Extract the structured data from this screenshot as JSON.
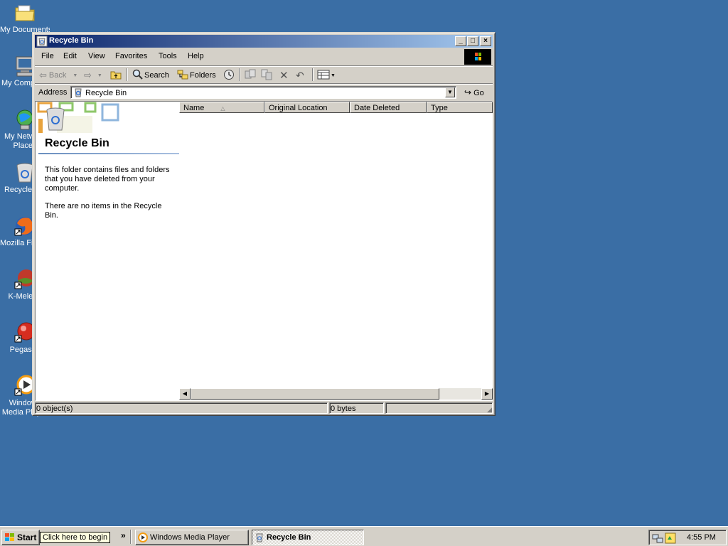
{
  "desktop": {
    "icons": [
      {
        "label": "My Documents",
        "icon": "folder-icon"
      },
      {
        "label": "My Computer",
        "icon": "computer-icon"
      },
      {
        "label": "My Network Places",
        "icon": "network-icon"
      },
      {
        "label": "Recycle Bin",
        "icon": "recycle-bin-icon"
      },
      {
        "label": "Mozilla Firefox",
        "icon": "firefox-icon"
      },
      {
        "label": "K-Meleon",
        "icon": "k-meleon-icon"
      },
      {
        "label": "Pegasus",
        "icon": "pegasus-icon"
      },
      {
        "label": "Windows Media Player",
        "icon": "media-player-icon"
      }
    ]
  },
  "window": {
    "title": "Recycle Bin",
    "menu": [
      "File",
      "Edit",
      "View",
      "Favorites",
      "Tools",
      "Help"
    ],
    "toolbar": {
      "back": "Back",
      "search": "Search",
      "folders": "Folders"
    },
    "address": {
      "label": "Address",
      "value": "Recycle Bin",
      "go": "Go"
    },
    "left_pane": {
      "title": "Recycle Bin",
      "description": "This folder contains files and folders that you have deleted from your computer.",
      "empty_message": "There are no items in the Recycle Bin."
    },
    "columns": [
      "Name",
      "Original Location",
      "Date Deleted",
      "Type"
    ],
    "status": {
      "objects": "0 object(s)",
      "size": "0 bytes"
    }
  },
  "taskbar": {
    "start": "Start",
    "tooltip": "Click here to begin",
    "more": "»",
    "tasks": [
      {
        "label": "Windows Media Player",
        "active": false
      },
      {
        "label": "Recycle Bin",
        "active": true
      }
    ],
    "clock": "4:55 PM"
  },
  "colors": {
    "desktop": "#3a6ea5",
    "title_start": "#0a246a",
    "title_end": "#a6caf0",
    "face": "#d4d0c8"
  }
}
